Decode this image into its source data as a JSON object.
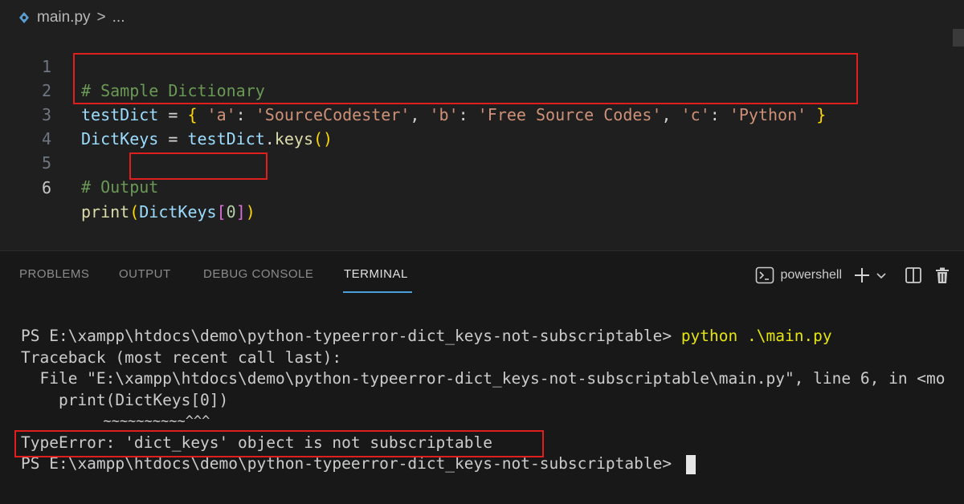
{
  "breadcrumb": {
    "file": "main.py",
    "separator": ">",
    "more": "..."
  },
  "editor": {
    "lines": [
      {
        "num": "1",
        "comment": "# Sample Dictionary"
      },
      {
        "num": "2",
        "var": "testDict",
        "eq": " = ",
        "ob": "{ ",
        "k1": "'a'",
        "c1": ": ",
        "v1": "'SourceCodester'",
        "s1": ", ",
        "k2": "'b'",
        "c2": ": ",
        "v2": "'Free Source Codes'",
        "s2": ", ",
        "k3": "'c'",
        "c3": ": ",
        "v3": "'Python'",
        "cb": " }"
      },
      {
        "num": "3",
        "var": "DictKeys",
        "eq": " = ",
        "obj": "testDict",
        "dot": ".",
        "fn": "keys",
        "parens": "()"
      },
      {
        "num": "4"
      },
      {
        "num": "5",
        "comment": "# Output"
      },
      {
        "num": "6",
        "fn": "print",
        "op": "(",
        "arg": "DictKeys",
        "bo": "[",
        "idx": "0",
        "bc": "]",
        "cp": ")"
      }
    ]
  },
  "panel": {
    "tabs": [
      "PROBLEMS",
      "OUTPUT",
      "DEBUG CONSOLE",
      "TERMINAL"
    ],
    "active_tab": "TERMINAL",
    "shell": "powershell"
  },
  "terminal": {
    "prompt1": "PS E:\\xampp\\htdocs\\demo\\python-typeerror-dict_keys-not-subscriptable> ",
    "cmd": "python .\\main.py",
    "traceback": "Traceback (most recent call last):",
    "file_line": "  File \"E:\\xampp\\htdocs\\demo\\python-typeerror-dict_keys-not-subscriptable\\main.py\", line 6, in <mo",
    "code_line": "    print(DictKeys[0])",
    "caret_line": "          ~~~~~~~~~~^^^",
    "error": "TypeError: 'dict_keys' object is not subscriptable",
    "prompt2": "PS E:\\xampp\\htdocs\\demo\\python-typeerror-dict_keys-not-subscriptable> "
  },
  "colors": {
    "highlight": "#e01e1e",
    "accent": "#4a9eda"
  }
}
